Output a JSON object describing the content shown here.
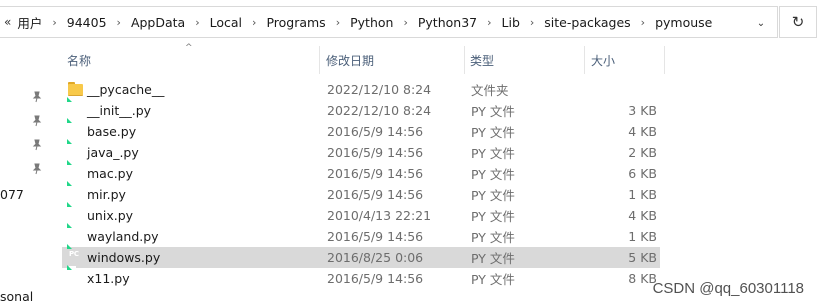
{
  "address_bar": {
    "overflow_glyph": "«",
    "breadcrumbs": [
      "用户",
      "94405",
      "AppData",
      "Local",
      "Programs",
      "Python",
      "Python37",
      "Lib",
      "site-packages",
      "pymouse"
    ],
    "separator": "›",
    "dropdown_glyph": "⌄",
    "refresh_glyph": "↻"
  },
  "nav_pane": {
    "fragments": [
      "077",
      "sonal"
    ],
    "pin_icons": [
      "pin-icon",
      "pin-icon",
      "pin-icon",
      "pin-icon"
    ]
  },
  "columns": {
    "name": "名称",
    "date": "修改日期",
    "type": "类型",
    "size": "大小",
    "sort_indicator": "^"
  },
  "files": [
    {
      "name": "__pycache__",
      "date": "2022/12/10 8:24",
      "type": "文件夹",
      "size": "",
      "icon": "folder-icon",
      "selected": false
    },
    {
      "name": "__init__.py",
      "date": "2022/12/10 8:24",
      "type": "PY 文件",
      "size": "3 KB",
      "icon": "pycharm-file-icon",
      "selected": false
    },
    {
      "name": "base.py",
      "date": "2016/5/9 14:56",
      "type": "PY 文件",
      "size": "4 KB",
      "icon": "pycharm-file-icon",
      "selected": false
    },
    {
      "name": "java_.py",
      "date": "2016/5/9 14:56",
      "type": "PY 文件",
      "size": "2 KB",
      "icon": "pycharm-file-icon",
      "selected": false
    },
    {
      "name": "mac.py",
      "date": "2016/5/9 14:56",
      "type": "PY 文件",
      "size": "6 KB",
      "icon": "pycharm-file-icon",
      "selected": false
    },
    {
      "name": "mir.py",
      "date": "2016/5/9 14:56",
      "type": "PY 文件",
      "size": "1 KB",
      "icon": "pycharm-file-icon",
      "selected": false
    },
    {
      "name": "unix.py",
      "date": "2010/4/13 22:21",
      "type": "PY 文件",
      "size": "4 KB",
      "icon": "pycharm-file-icon",
      "selected": false
    },
    {
      "name": "wayland.py",
      "date": "2016/5/9 14:56",
      "type": "PY 文件",
      "size": "1 KB",
      "icon": "pycharm-file-icon",
      "selected": false
    },
    {
      "name": "windows.py",
      "date": "2016/8/25 0:06",
      "type": "PY 文件",
      "size": "5 KB",
      "icon": "pycharm-file-icon",
      "selected": true
    },
    {
      "name": "x11.py",
      "date": "2016/5/9 14:56",
      "type": "PY 文件",
      "size": "8 KB",
      "icon": "pycharm-file-icon",
      "selected": false
    }
  ],
  "watermark": "CSDN @qq_60301118",
  "colors": {
    "selected_row": "#d9d9d9",
    "header_text": "#4c607a",
    "secondary_text": "#6d6d6d",
    "folder": "#f8c94a",
    "pycharm_accent": "#21d789"
  }
}
